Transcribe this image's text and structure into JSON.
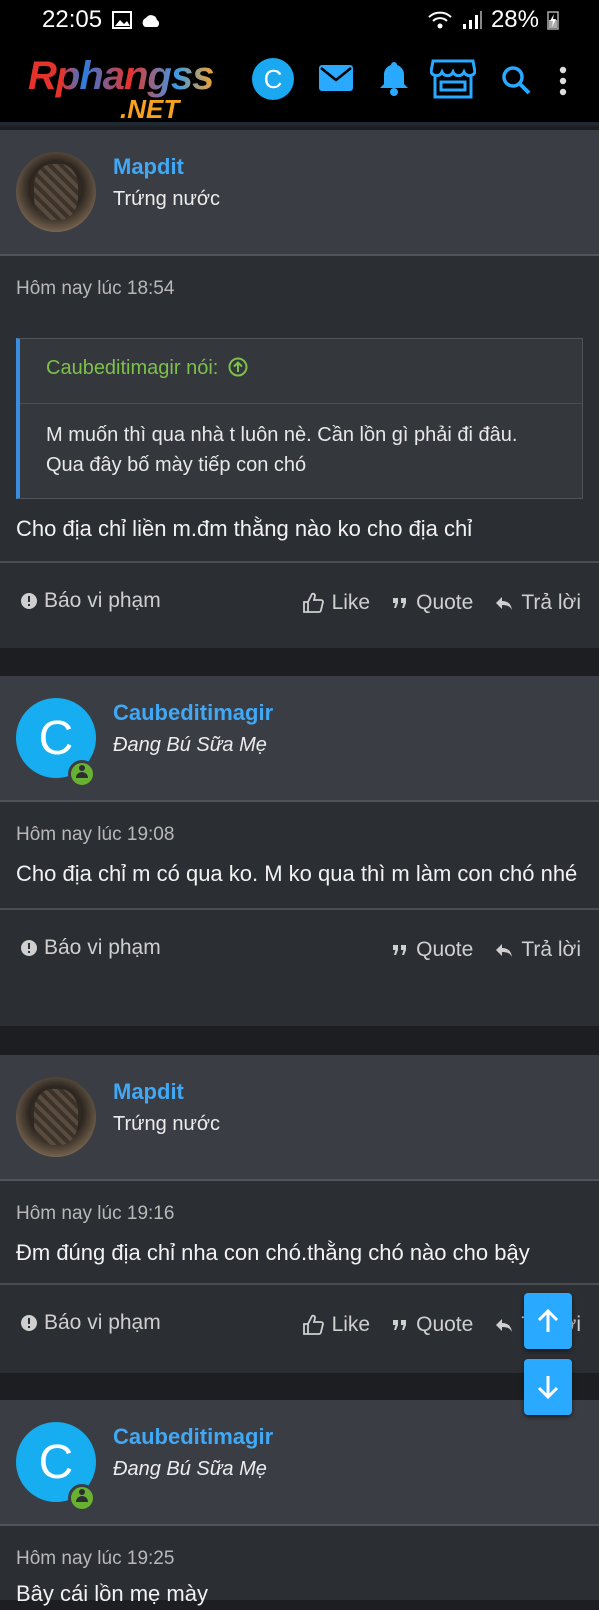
{
  "status_bar": {
    "time": "22:05",
    "battery": "28%"
  },
  "header": {
    "logo_line1": "Rphangss",
    "logo_line2": ".NET",
    "account_letter": "C",
    "icons": [
      "mail-icon",
      "bell-icon",
      "store-icon",
      "search-icon",
      "more-vertical-icon"
    ]
  },
  "posts": [
    {
      "username": "Mapdit",
      "user_title": "Trứng nước",
      "timestamp": "Hôm nay lúc 18:54",
      "quote": {
        "author_line": "Caubeditimagir nói:",
        "text": "M muốn thì qua nhà t luôn nè. Cần lồn gì phải đi đâu. Qua đây bố mày tiếp con chó"
      },
      "message": "Cho địa chỉ liền m.đm thằng nào ko cho địa chỉ",
      "actions": {
        "report": "Báo vi phạm",
        "like": "Like",
        "quote": "Quote",
        "reply": "Trả lời"
      }
    },
    {
      "username": "Caubeditimagir",
      "avatar_letter": "C",
      "user_title": "Đang Bú Sữa Mẹ",
      "timestamp": "Hôm nay lúc 19:08",
      "message": "Cho địa chỉ m có qua ko. M ko qua thì m làm con chó nhé",
      "actions": {
        "report": "Báo vi phạm",
        "quote": "Quote",
        "reply": "Trả lời"
      }
    },
    {
      "username": "Mapdit",
      "user_title": "Trứng nước",
      "timestamp": "Hôm nay lúc 19:16",
      "message": "Đm đúng địa chỉ nha con chó.thằng chó nào cho bậy",
      "actions": {
        "report": "Báo vi phạm",
        "like": "Like",
        "quote": "Quote",
        "reply": "Trả lời"
      }
    },
    {
      "username": "Caubeditimagir",
      "avatar_letter": "C",
      "user_title": "Đang Bú Sữa Mẹ",
      "timestamp": "Hôm nay lúc 19:25",
      "message": "Bây cái lồn mẹ mày"
    }
  ],
  "colors": {
    "accent": "#29a9ff",
    "username": "#41a8f5",
    "quote_author": "#7dc04b",
    "online": "#69b130"
  }
}
